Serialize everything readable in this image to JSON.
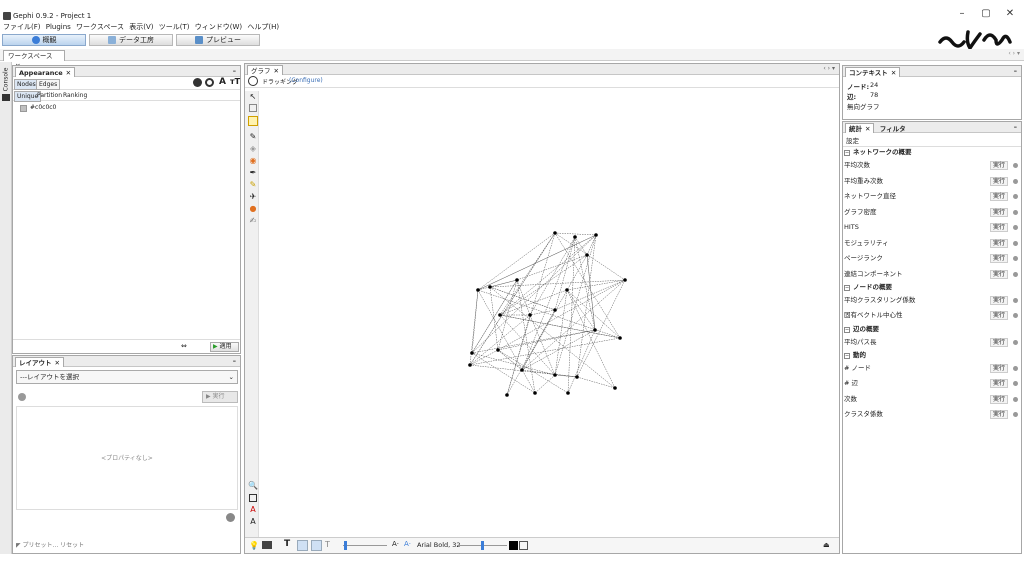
{
  "window": {
    "title": "Gephi 0.9.2 - Project 1",
    "controls": [
      "–",
      "▢",
      "✕"
    ]
  },
  "menu": [
    "ファイル(F)",
    "Plugins",
    "ワークスペース",
    "表示(V)",
    "ツール(T)",
    "ウィンドウ(W)",
    "ヘルプ(H)"
  ],
  "modes": [
    "概観",
    "データ工房",
    "プレビュー"
  ],
  "logo_text": "ԑɛɪɐ",
  "workspace_tab": "ワークスペース 1",
  "appearance": {
    "title": "Appearance",
    "tabs": [
      "Nodes",
      "Edges"
    ],
    "subtabs": [
      "Unique",
      "Partition",
      "Ranking"
    ],
    "color_value": "#c0c0c0",
    "apply_label": "適用"
  },
  "layout_panel": {
    "title": "レイアウト",
    "select_value": "---レイアウトを選択",
    "run_label": "実行",
    "no_props": "<プロパティなし>",
    "preset_label": "プリセット... リセット"
  },
  "graph_panel": {
    "title": "グラフ",
    "tool_label": "ドラッギング",
    "configure_label": "(Configure)",
    "font_label": "Arial Bold, 32"
  },
  "context": {
    "title": "コンテキスト",
    "nodes_label": "ノード:",
    "nodes_value": "24",
    "edges_label": "辺:",
    "edges_value": "78",
    "graph_type": "無向グラフ"
  },
  "stats": {
    "tab1": "統計",
    "tab2": "フィルタ",
    "settings": "設定",
    "run_label": "実行",
    "sections": [
      {
        "title": "ネットワークの概要",
        "items": [
          "平均次数",
          "平均重み次数",
          "ネットワーク直径",
          "グラフ密度",
          "HITS",
          "モジュラリティ",
          "ページランク",
          "連結コンポーネント"
        ]
      },
      {
        "title": "ノードの概要",
        "items": [
          "平均クラスタリング係数",
          "固有ベクトル中心性"
        ]
      },
      {
        "title": "辺の概要",
        "items": [
          "平均パス長"
        ]
      },
      {
        "title": "動的",
        "items": [
          "# ノード",
          "# 辺",
          "次数",
          "クラスタ係数"
        ]
      }
    ]
  },
  "colors": {
    "accent": "#3b7dd8",
    "panel_border": "#a7a7a7",
    "node": "#000000",
    "edge": "#555555"
  }
}
